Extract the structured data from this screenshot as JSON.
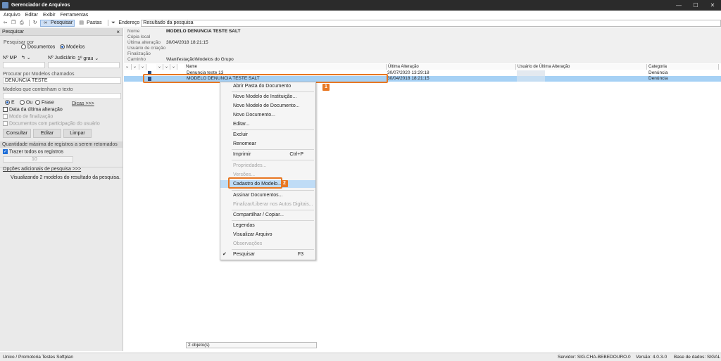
{
  "window": {
    "title": "Gerenciador de Arquivos",
    "min": "—",
    "max": "☐",
    "close": "✕"
  },
  "menu": [
    "Arquivo",
    "Editar",
    "Exibir",
    "Ferramentas"
  ],
  "toolbar": {
    "search": "Pesquisar",
    "folders": "Pastas",
    "address_label": "Endereço",
    "address_value": "Resultado da pesquisa"
  },
  "left": {
    "header": "Pesquisar",
    "close": "×",
    "search_by": "Pesquisar por",
    "opt_documents": "Documentos",
    "opt_models": "Modelos",
    "nmp": "Nº MP",
    "njudicial": "Nº Judiciário",
    "grau": "1º grau",
    "models_named_label": "Procurar por Modelos chamados",
    "models_named_value": "DENUNCIA TESTE",
    "models_text_label": "Modelos que contenham o texto",
    "opt_e": "E",
    "opt_ou": "Ou",
    "opt_frase": "Frase",
    "tips": "Dicas >>>",
    "chk_last_change": "Data da última alteração",
    "chk_finalize": "Modo de finalização",
    "chk_participation": "Documentos com participação do usuário",
    "btn_consult": "Consultar",
    "btn_edit": "Editar",
    "btn_clear": "Limpar",
    "max_records": "Quantidade máxima de registros a serem retornados",
    "chk_all": "Trazer todos os registros",
    "max_value": "10",
    "more_options": "Opções adicionais de pesquisa >>>",
    "result_text": "Visualizando 2 modelos do resultado da pesquisa."
  },
  "props": {
    "name_label": "Nome",
    "name_value": "MODELO DENUNCIA TESTE SALT",
    "local_label": "Cópia local",
    "changed_label": "Última alteração",
    "changed_value": "30/04/2018 18:21:15",
    "creator_label": "Usuário de criação",
    "final_label": "Finalização",
    "path_label": "Caminho",
    "path_value": "\\Manifestação\\Modelos do Grupo"
  },
  "columns": {
    "name": "Name",
    "changed": "Última Alteração",
    "user": "Usuário de Última Alteração",
    "category": "Categoria"
  },
  "rows": [
    {
      "name": "Denuncia teste 13",
      "changed": "30/07/2020 13:29:18",
      "category": "Denúncia"
    },
    {
      "name": "MODELO DENUNCIA TESTE SALT",
      "changed": "30/04/2018 18:21:15",
      "category": "Denúncia"
    }
  ],
  "badges": {
    "one": "1",
    "two": "2"
  },
  "context_menu": {
    "open_folder": "Abrir Pasta do Documento",
    "new_inst": "Novo Modelo de Instituição...",
    "new_doc_model": "Novo Modelo de Documento...",
    "new_doc": "Novo Documento...",
    "edit": "Editar...",
    "delete": "Excluir",
    "rename": "Renomear",
    "print": "Imprimir",
    "print_sc": "Ctrl+P",
    "properties": "Propriedades...",
    "versions": "Versões...",
    "register": "Cadastro do Modelo...",
    "sign": "Assinar Documentos...",
    "finalize": "Finalizar/Liberar nos Autos Digitais...",
    "share": "Compartilhar / Copiar...",
    "legends": "Legendas",
    "view_file": "Visualizar Arquivo",
    "notes": "Observações",
    "search": "Pesquisar",
    "search_sc": "F3"
  },
  "status": {
    "objects": "2 objeto(s)",
    "left": "Unico / Promotoria Testes Softplan",
    "server": "Servidor: SIG.CHA-BEBEDOURO.0",
    "version": "Versão: 4.0.3-0",
    "db": "Base de dados: SIGAL"
  },
  "colors": {
    "accent": "#e87722",
    "selection": "#a6d1f5",
    "menu_hover": "#bfdcf6"
  }
}
